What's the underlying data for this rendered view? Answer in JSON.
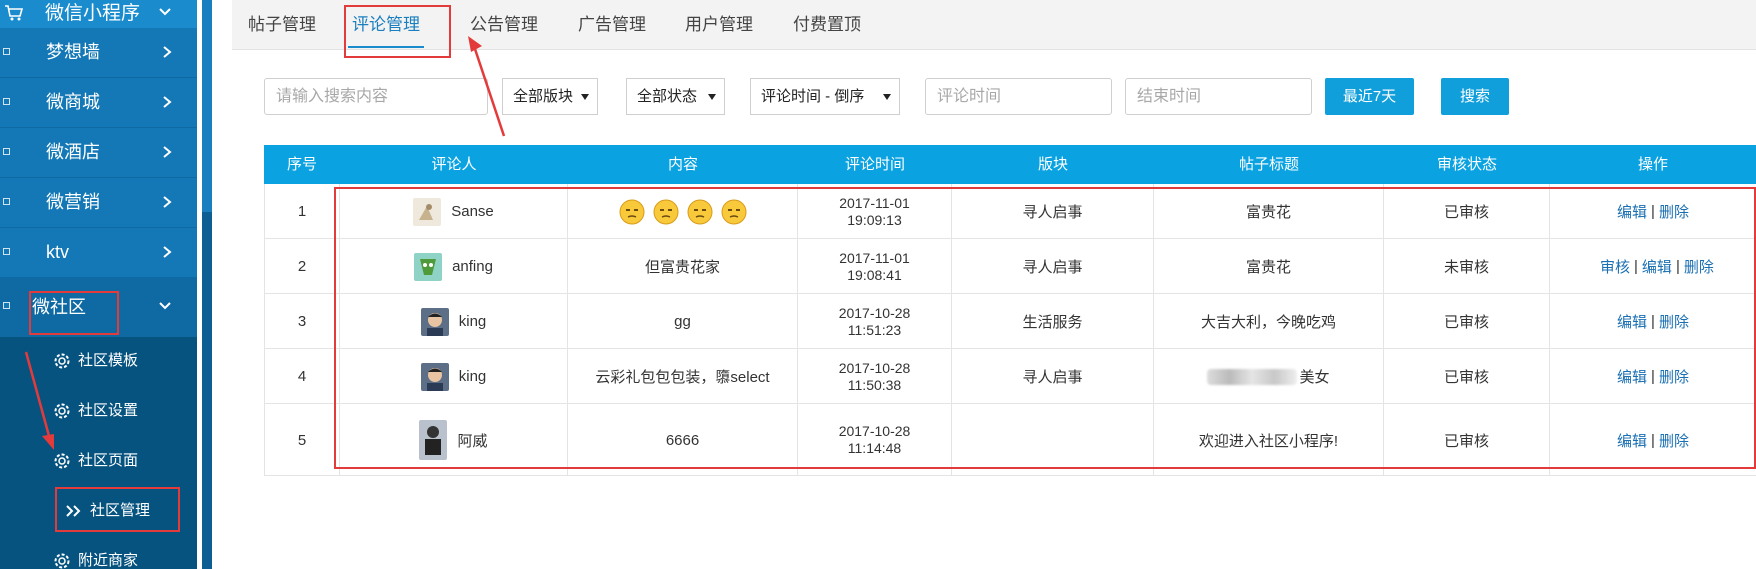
{
  "sidebar": {
    "header": "微信小程序",
    "items": [
      {
        "label": "梦想墙"
      },
      {
        "label": "微商城"
      },
      {
        "label": "微酒店"
      },
      {
        "label": "微营销"
      },
      {
        "label": "ktv"
      },
      {
        "label": "微社区"
      }
    ],
    "sub_items": [
      {
        "label": "社区模板"
      },
      {
        "label": "社区设置"
      },
      {
        "label": "社区页面"
      },
      {
        "label": "社区管理"
      },
      {
        "label": "附近商家"
      }
    ]
  },
  "tabs": [
    {
      "label": "帖子管理"
    },
    {
      "label": "评论管理"
    },
    {
      "label": "公告管理"
    },
    {
      "label": "广告管理"
    },
    {
      "label": "用户管理"
    },
    {
      "label": "付费置顶"
    }
  ],
  "filters": {
    "search_placeholder": "请输入搜索内容",
    "section_select": "全部版块",
    "status_select": "全部状态",
    "sort_select": "评论时间 - 倒序",
    "start_time_placeholder": "评论时间",
    "end_time_placeholder": "结束时间",
    "last7_button": "最近7天",
    "search_button": "搜索"
  },
  "table": {
    "columns": [
      "序号",
      "评论人",
      "内容",
      "评论时间",
      "版块",
      "帖子标题",
      "审核状态",
      "操作"
    ],
    "rows": [
      {
        "index": "1",
        "user": "Sanse",
        "content": "",
        "date": "2017-11-01",
        "time": "19:09:13",
        "section": "寻人启事",
        "title": "富贵花",
        "status": "已审核"
      },
      {
        "index": "2",
        "user": "anfing",
        "content": "但富贵花家",
        "date": "2017-11-01",
        "time": "19:08:41",
        "section": "寻人启事",
        "title": "富贵花",
        "status": "未审核"
      },
      {
        "index": "3",
        "user": "king",
        "content": "gg",
        "date": "2017-10-28",
        "time": "11:51:23",
        "section": "生活服务",
        "title": "大吉大利，今晚吃鸡",
        "status": "已审核"
      },
      {
        "index": "4",
        "user": "king",
        "content": "云彩礼包包包装，隳select",
        "date": "2017-10-28",
        "time": "11:50:38",
        "section": "寻人启事",
        "title": "美女",
        "status": "已审核"
      },
      {
        "index": "5",
        "user": "阿威",
        "content": "6666",
        "date": "2017-10-28",
        "time": "11:14:48",
        "section": "",
        "title": "欢迎进入社区小程序!",
        "status": "已审核"
      }
    ],
    "op_audit": "审核",
    "op_edit": "编辑",
    "op_delete": "删除",
    "op_sep": "|"
  },
  "colors": {
    "sidebar_bg": "#1a7fbf",
    "submenu_bg": "#06537f",
    "header_blue": "#0aa2e0",
    "button_blue": "#119fdc",
    "annotation_red": "#e33b3b"
  }
}
